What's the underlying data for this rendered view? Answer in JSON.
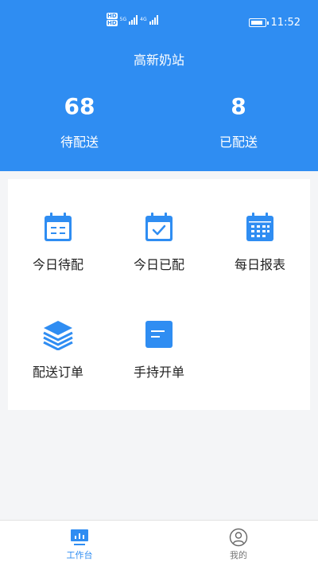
{
  "status_bar": {
    "hd1": "HD",
    "hd2": "HD",
    "network1": "5G",
    "network2": "4G",
    "time": "11:52"
  },
  "header": {
    "station_name": "高新奶站",
    "stats": [
      {
        "value": "68",
        "label": "待配送"
      },
      {
        "value": "8",
        "label": "已配送"
      }
    ]
  },
  "menu": {
    "items": [
      {
        "label": "今日待配",
        "icon": "calendar-list-icon"
      },
      {
        "label": "今日已配",
        "icon": "calendar-check-icon"
      },
      {
        "label": "每日报表",
        "icon": "calendar-grid-icon"
      },
      {
        "label": "配送订单",
        "icon": "layers-icon"
      },
      {
        "label": "手持开单",
        "icon": "document-icon"
      }
    ]
  },
  "tabbar": {
    "tabs": [
      {
        "label": "工作台",
        "icon": "workbench-icon",
        "active": true
      },
      {
        "label": "我的",
        "icon": "user-icon",
        "active": false
      }
    ]
  },
  "colors": {
    "primary": "#2f8df2",
    "background": "#f4f5f7",
    "card": "#ffffff"
  }
}
